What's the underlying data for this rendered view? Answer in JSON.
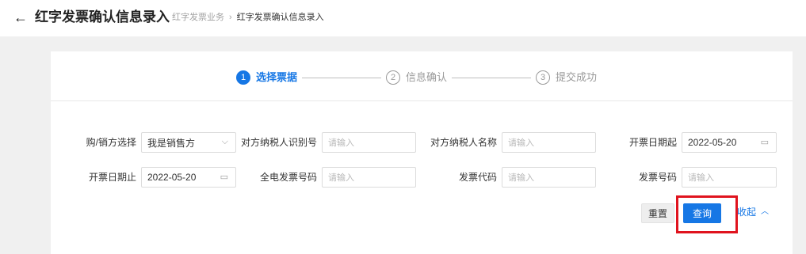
{
  "header": {
    "back_glyph": "←",
    "title": "红字发票确认信息录入",
    "breadcrumb": [
      "红字发票业务",
      "红字发票确认信息录入"
    ],
    "breadcrumb_sep": "›"
  },
  "steps": [
    {
      "num": "1",
      "label": "选择票据",
      "state": "active"
    },
    {
      "num": "2",
      "label": "信息确认",
      "state": "inactive"
    },
    {
      "num": "3",
      "label": "提交成功",
      "state": "inactive"
    }
  ],
  "form": {
    "buyer_seller": {
      "label": "购/销方选择",
      "value": "我是销售方",
      "icon": "chevron-down-icon"
    },
    "counterparty_tax_id": {
      "label": "对方纳税人识别号",
      "placeholder": "请输入"
    },
    "counterparty_name": {
      "label": "对方纳税人名称",
      "placeholder": "请输入"
    },
    "issue_date_start": {
      "label": "开票日期起",
      "value": "2022-05-20",
      "icon": "calendar-icon"
    },
    "issue_date_end": {
      "label": "开票日期止",
      "value": "2022-05-20",
      "icon": "calendar-icon"
    },
    "full_e_invoice_no": {
      "label": "全电发票号码",
      "placeholder": "请输入"
    },
    "invoice_code": {
      "label": "发票代码",
      "placeholder": "请输入"
    },
    "invoice_no": {
      "label": "发票号码",
      "placeholder": "请输入"
    }
  },
  "actions": {
    "reset": "重置",
    "query": "查询",
    "collapse": "收起",
    "collapse_glyph": "︿"
  },
  "colors": {
    "accent": "#1677e5",
    "highlight": "#e0131e",
    "background": "#f0f0f0"
  }
}
